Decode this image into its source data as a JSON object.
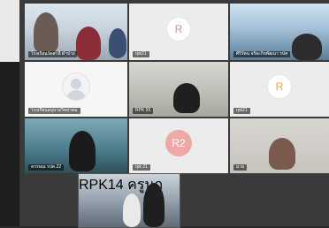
{
  "participants": [
    {
      "name": "โรงเรียนวัดสาลี ดำปาง",
      "type": "video"
    },
    {
      "name": "rpk21",
      "type": "avatar",
      "initial": "R"
    },
    {
      "name": "ศิริรัตน จริยะกิจพัฒนา รปค",
      "type": "video"
    },
    {
      "name": "โรงเรียนอนุบาลวิทยาคม",
      "type": "generic-avatar"
    },
    {
      "name": "RPK 55",
      "type": "video"
    },
    {
      "name": "rpk21",
      "type": "avatar",
      "initial": "R"
    },
    {
      "name": "ครรษณ รปค.22",
      "type": "video"
    },
    {
      "name": "rpk 21",
      "type": "avatar",
      "initial": "R2"
    },
    {
      "name": "มาย",
      "type": "video"
    }
  ],
  "self_view": {
    "name": "RPK14 ครูนก"
  },
  "colors": {
    "avatar_pink": "#c6938a",
    "avatar_orange": "#e7a04b",
    "r2_bg": "#eea8a5"
  }
}
